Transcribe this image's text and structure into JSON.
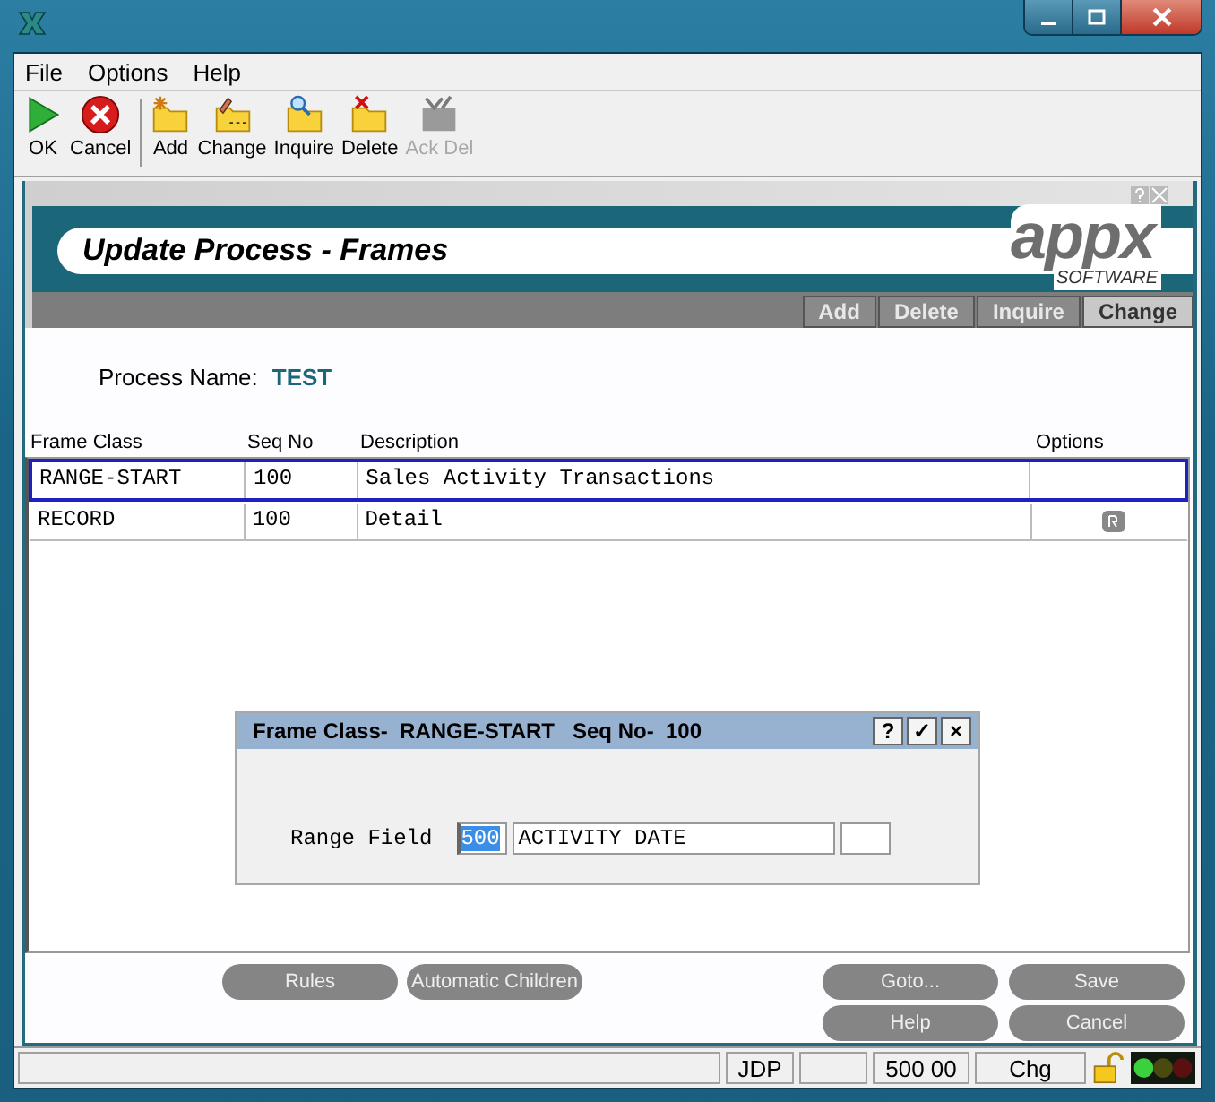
{
  "menu": [
    {
      "label": "File"
    },
    {
      "label": "Options"
    },
    {
      "label": "Help"
    }
  ],
  "toolbar": [
    {
      "kind": "ok",
      "label": "OK",
      "disabled": false
    },
    {
      "kind": "cancel",
      "label": "Cancel",
      "disabled": false
    },
    {
      "kind": "add",
      "label": "Add",
      "disabled": false
    },
    {
      "kind": "change",
      "label": "Change",
      "disabled": false
    },
    {
      "kind": "inquire",
      "label": "Inquire",
      "disabled": false
    },
    {
      "kind": "delete",
      "label": "Delete",
      "disabled": false
    },
    {
      "kind": "ackdel",
      "label": "Ack Del",
      "disabled": true
    }
  ],
  "header": {
    "title": "Update Process - Frames",
    "logo": "appx",
    "logo_tagline": "SOFTWARE",
    "tabs": [
      {
        "label": "Add",
        "selected": false
      },
      {
        "label": "Delete",
        "selected": false
      },
      {
        "label": "Inquire",
        "selected": false
      },
      {
        "label": "Change",
        "selected": true
      }
    ]
  },
  "process_name": {
    "label": "Process Name:",
    "value": "TEST"
  },
  "table": {
    "columns": [
      "Frame Class",
      "Seq No",
      "Description",
      "Options"
    ],
    "rows": [
      {
        "cells": [
          "RANGE-START",
          "100",
          "Sales Activity Transactions"
        ],
        "options_button": false,
        "selected": true
      },
      {
        "cells": [
          "RECORD",
          "100",
          "Detail"
        ],
        "options_button": true,
        "selected": false
      }
    ]
  },
  "dialog": {
    "title": "Frame Class-  RANGE-START   Seq No-  100",
    "buttons": [
      "?",
      "✓",
      "×"
    ],
    "field_label": "Range Field",
    "code": "500",
    "code_selected": true,
    "value": "ACTIVITY DATE"
  },
  "buttons_left": [
    "Rules",
    "Automatic Children"
  ],
  "buttons_right": [
    "Goto...",
    "Save",
    "Help",
    "Cancel"
  ],
  "status_bar": {
    "user": "JDP",
    "record": "500 00",
    "mode": "Chg"
  }
}
